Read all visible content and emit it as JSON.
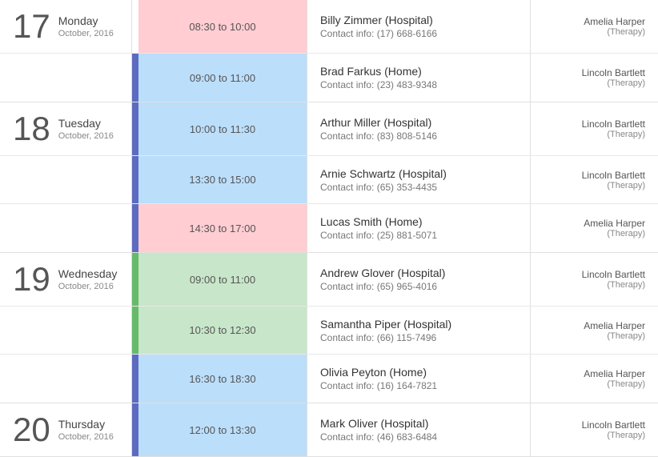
{
  "calendar": {
    "days": [
      {
        "date_number": "17",
        "day_name": "Monday",
        "month_year": "October, 2016",
        "events": [
          {
            "time": "08:30 to 10:00",
            "time_color": "time-pink",
            "bar_color": "bar-empty",
            "name": "Billy Zimmer (Hospital)",
            "contact": "Contact info: (17) 668-6166",
            "therapist": "Amelia Harper",
            "therapy_type": "(Therapy)"
          },
          {
            "time": "09:00 to 11:00",
            "time_color": "time-blue",
            "bar_color": "bar-blue",
            "name": "Brad Farkus (Home)",
            "contact": "Contact info: (23) 483-9348",
            "therapist": "Lincoln Bartlett",
            "therapy_type": "(Therapy)"
          }
        ]
      },
      {
        "date_number": "18",
        "day_name": "Tuesday",
        "month_year": "October, 2016",
        "events": [
          {
            "time": "10:00 to 11:30",
            "time_color": "time-blue",
            "bar_color": "bar-blue",
            "name": "Arthur Miller (Hospital)",
            "contact": "Contact info: (83) 808-5146",
            "therapist": "Lincoln Bartlett",
            "therapy_type": "(Therapy)"
          },
          {
            "time": "13:30 to 15:00",
            "time_color": "time-blue",
            "bar_color": "bar-blue",
            "name": "Arnie Schwartz (Hospital)",
            "contact": "Contact info: (65) 353-4435",
            "therapist": "Lincoln Bartlett",
            "therapy_type": "(Therapy)"
          },
          {
            "time": "14:30 to 17:00",
            "time_color": "time-pink",
            "bar_color": "bar-blue",
            "name": "Lucas Smith (Home)",
            "contact": "Contact info: (25) 881-5071",
            "therapist": "Amelia Harper",
            "therapy_type": "(Therapy)"
          }
        ]
      },
      {
        "date_number": "19",
        "day_name": "Wednesday",
        "month_year": "October, 2016",
        "events": [
          {
            "time": "09:00 to 11:00",
            "time_color": "time-green",
            "bar_color": "bar-green",
            "name": "Andrew Glover (Hospital)",
            "contact": "Contact info: (65) 965-4016",
            "therapist": "Lincoln Bartlett",
            "therapy_type": "(Therapy)"
          },
          {
            "time": "10:30 to 12:30",
            "time_color": "time-green",
            "bar_color": "bar-green",
            "name": "Samantha Piper (Hospital)",
            "contact": "Contact info: (66) 115-7496",
            "therapist": "Amelia Harper",
            "therapy_type": "(Therapy)"
          },
          {
            "time": "16:30 to 18:30",
            "time_color": "time-blue",
            "bar_color": "bar-blue",
            "name": "Olivia Peyton (Home)",
            "contact": "Contact info: (16) 164-7821",
            "therapist": "Amelia Harper",
            "therapy_type": "(Therapy)"
          }
        ]
      },
      {
        "date_number": "20",
        "day_name": "Thursday",
        "month_year": "October, 2016",
        "events": [
          {
            "time": "12:00 to 13:30",
            "time_color": "time-blue",
            "bar_color": "bar-blue",
            "name": "Mark Oliver (Hospital)",
            "contact": "Contact info: (46) 683-6484",
            "therapist": "Lincoln Bartlett",
            "therapy_type": "(Therapy)"
          }
        ]
      }
    ]
  }
}
